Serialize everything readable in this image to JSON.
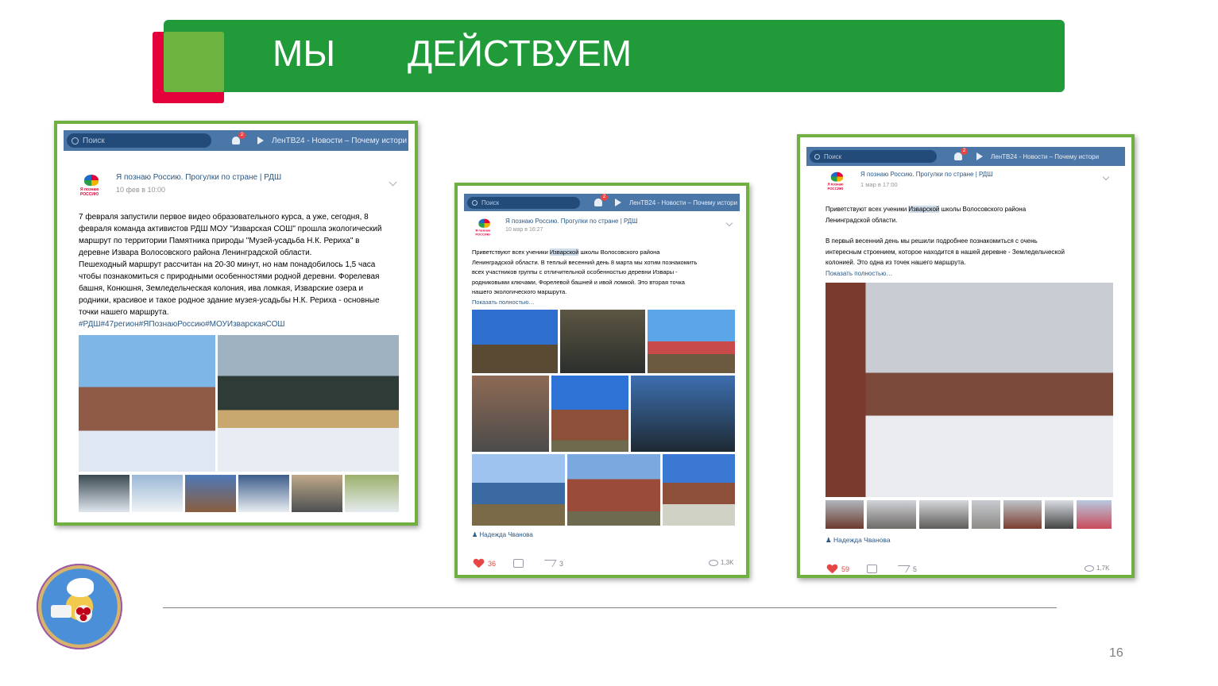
{
  "slide": {
    "title_word_1": "МЫ",
    "title_word_2": "ДЕЙСТВУЕМ",
    "page_number": "16"
  },
  "vk_common": {
    "search_placeholder": "Поиск",
    "notifications_badge": "2",
    "now_playing": "ЛенТВ24 - Новости – Почему истори",
    "group_name": "Я познаю Россию. Прогулки по стране | РДШ",
    "logo_text": "Я познаю РОССИЮ"
  },
  "post1": {
    "date": "10 фев в 10:00",
    "text_lines": [
      "7 февраля запустили первое видео образовательного курса, а уже, сегодня, 8",
      "февраля команда активистов РДШ МОУ \"Изварская СОШ\" прошла экологический",
      "маршрут по территории Памятника природы \"Музей-усадьба Н.К. Рериха\" в",
      "деревне Извара Волосовского района Ленинградской области.",
      "Пешеходный маршрут рассчитан на 20-30 минут, но нам понадобилось 1,5 часа",
      "чтобы познакомиться с природными особенностями родной деревни. Форелевая",
      "башня, Конюшня, Земледельческая колония, ива ломкая, Изварские озера и",
      "родники, красивое и такое родное здание музея-усадьбы Н.К. Рериха - основные",
      "точки нашего маршрута."
    ],
    "hashtags": "#РДШ#47регион#ЯПознаюРоссию#МОУИзварскаяСОШ"
  },
  "post2": {
    "date": "10 мар в 16:27",
    "text_before": "Приветствуют всех ученики ",
    "highlight": "Изварской",
    "text_lines_after": [
      " школы Волосовского района",
      "Ленинградской области. В теплый весенний день 8 марта мы хотим познакомить",
      "всех участников группы с отличительной особенностью деревни Извары -",
      "родниковыми ключами, Форелевой башней и ивой ломкой. Это вторая точка",
      "нашего экологического маршрута."
    ],
    "show_more": "Показать полностью…",
    "author": "Надежда Чванова",
    "likes": "36",
    "shares": "3",
    "views": "1,3K"
  },
  "post3": {
    "date": "1 мар в 17:00",
    "text_before": "Приветствуют всех ученики ",
    "highlight": "Изварской",
    "text_line1_after": " школы Волосовского района",
    "text_line2": "Ленинградской области.",
    "paragraph2": [
      "В первый весенний день мы решили подробнее познакомиться с очень",
      "интересным строением, которое находится в нашей деревне - Земледельческой",
      "колонией. Это одна из точек нашего маршрута."
    ],
    "show_more": "Показать полностью…",
    "author": "Надежда Чванова",
    "likes": "59",
    "shares": "5",
    "views": "1,7K"
  },
  "colors": {
    "banner": "#219a3a",
    "accent_red": "#e4003a",
    "accent_lime": "#6db33f",
    "card_border": "#6fb040",
    "vk_blue": "#4a76a8",
    "link_blue": "#2a5885"
  }
}
